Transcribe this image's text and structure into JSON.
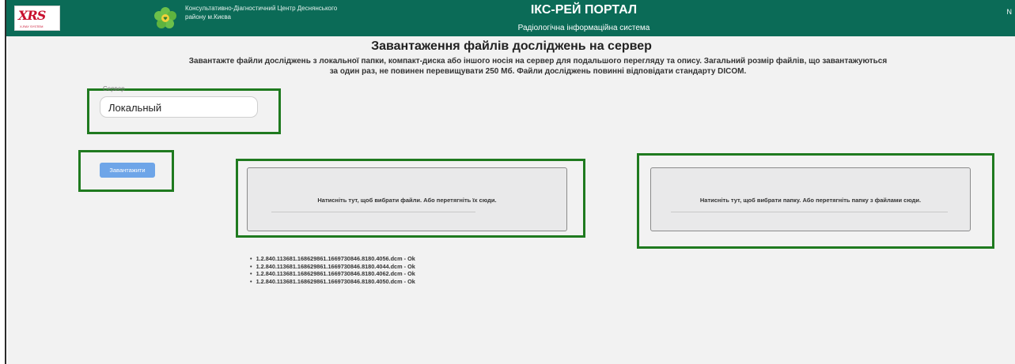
{
  "header": {
    "logo_text": "XRS",
    "logo_sub": "X-RAY SYSTEM",
    "clinic_line1": "Консультативно-Діагностичний Центр Деснянського",
    "clinic_line2": "району м.Києва",
    "portal_title": "ІКС-РЕЙ ПОРТАЛ",
    "portal_subtitle": "Радіологічна інформаційна система",
    "right_mark": "N",
    "color": "#0b6b57"
  },
  "page": {
    "title": "Завантаження файлів досліджень на сервер",
    "description_line1": "Завантажте файли досліджень з локальної папки, компакт-диска або іншого носія на сервер для подальшого перегляду та опису. Загальний розмір файлів, що завантажуються",
    "description_line2": "за один раз, не повинен перевищувати 250 Мб. Файли досліджень повинні відповідати стандарту DICOM."
  },
  "server": {
    "label": "Сервер",
    "value": "Локальный"
  },
  "upload_button": {
    "label": "Завантажити"
  },
  "dropzones": {
    "files_text": "Натисніть тут, щоб вибрати файли. Або перетягніть їх сюди.",
    "folder_text": "Натисніть тут, щоб вибрати папку. Або перетягніть папку з файлами сюди."
  },
  "uploaded_files": [
    "1.2.840.113681.168629861.1669730846.8180.4056.dcm - Ok",
    "1.2.840.113681.168629861.1669730846.8180.4044.dcm - Ok",
    "1.2.840.113681.168629861.1669730846.8180.4062.dcm - Ok",
    "1.2.840.113681.168629861.1669730846.8180.4050.dcm - Ok"
  ],
  "colors": {
    "highlight": "#1f7a1f",
    "button": "#6ea5e8"
  }
}
